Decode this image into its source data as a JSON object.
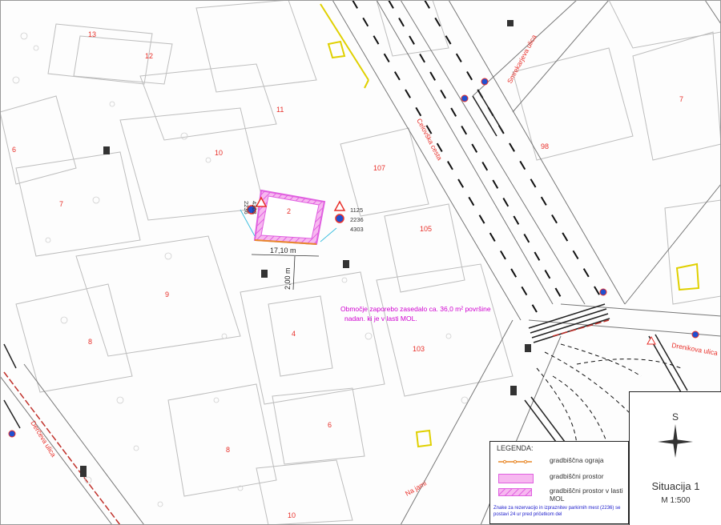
{
  "building_numbers": [
    "13",
    "12",
    "11",
    "10",
    "6",
    "7",
    "9",
    "8",
    "4",
    "107",
    "105",
    "103",
    "98",
    "7",
    "6",
    "8",
    "10",
    "2"
  ],
  "streets": {
    "celovska": "Celovška cesta",
    "smrekarjeva": "Smrekarjeva ulica",
    "drenikova": "Drenikova ulica",
    "na_jami": "Na jami",
    "derceva": "Derčeva ulica"
  },
  "site": {
    "number": "2",
    "width_label": "17,10 m",
    "depth_label": "2,00 m",
    "annotation_line1": "Območje zaporebo zasedalo ca. 36,0 m² površine",
    "annotation_line2": "nadan. ki je v lasti MOL."
  },
  "sign_codes": {
    "left": [
      "2236",
      "4303"
    ],
    "right": [
      "1125",
      "2236",
      "4303"
    ]
  },
  "compass": {
    "north_label": "S"
  },
  "legend": {
    "title": "LEGENDA:",
    "items": [
      {
        "label": "gradbiščna ograja",
        "symbol": "orange-fence-line"
      },
      {
        "label": "gradbiščni prostor",
        "symbol": "pink-fill"
      },
      {
        "label": "gradbiščni prostor v lasti MOL",
        "symbol": "pink-hatch"
      }
    ],
    "note": "Znake za rezervacijo in izpraznitev parkirnih mest (2236) se postavi 24 ur pred pričetkom del"
  },
  "title_block": {
    "title": "Situacija 1",
    "scale": "M 1:500"
  },
  "colors": {
    "fence": "#e8892a",
    "site_fill": "#f7b8f0",
    "site_border": "#e060e0",
    "labels": "#e8302a",
    "note": "#1a1acc"
  }
}
